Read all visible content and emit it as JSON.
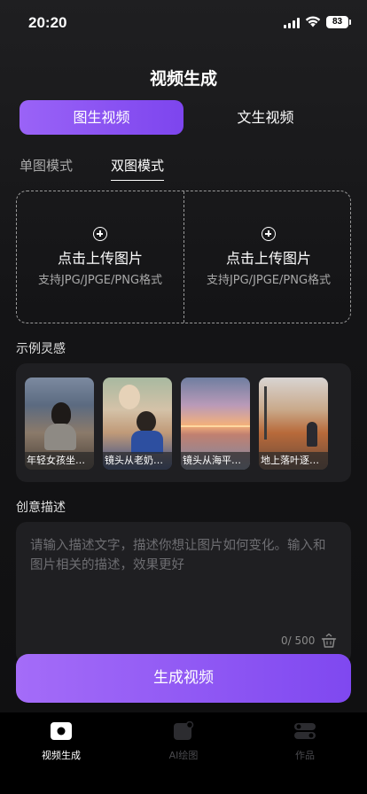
{
  "status_bar": {
    "time": "20:20",
    "battery": "83"
  },
  "header": {
    "title": "视频生成"
  },
  "segment_tabs": [
    {
      "label": "图生视频",
      "active": true
    },
    {
      "label": "文生视频",
      "active": false
    }
  ],
  "mode_tabs": [
    {
      "label": "单图模式",
      "active": false
    },
    {
      "label": "双图模式",
      "active": true
    }
  ],
  "upload": {
    "slots": [
      {
        "label": "点击上传图片",
        "hint": "支持JPG/JPGE/PNG格式"
      },
      {
        "label": "点击上传图片",
        "hint": "支持JPG/JPGE/PNG格式"
      }
    ]
  },
  "inspiration": {
    "label": "示例灵感",
    "items": [
      {
        "caption": "年轻女孩坐在咖啡馆"
      },
      {
        "caption": "镜头从老奶奶和男孩"
      },
      {
        "caption": "镜头从海平面缓缓"
      },
      {
        "caption": "地上落叶逐渐飘起"
      }
    ]
  },
  "description": {
    "label": "创意描述",
    "placeholder": "请输入描述文字，描述你想让图片如何变化。输入和图片相关的描述，效果更好",
    "value": "",
    "counter": "0/ 500"
  },
  "generate_button": {
    "label": "生成视频"
  },
  "tab_bar": {
    "items": [
      {
        "label": "视频生成",
        "icon": "video-icon",
        "active": true
      },
      {
        "label": "AI绘图",
        "icon": "ai-draw-icon",
        "active": false
      },
      {
        "label": "作品",
        "icon": "works-icon",
        "active": false
      }
    ]
  },
  "colors": {
    "accent": "#8b55f4",
    "background": "#141416",
    "panel": "#1f1f22"
  }
}
